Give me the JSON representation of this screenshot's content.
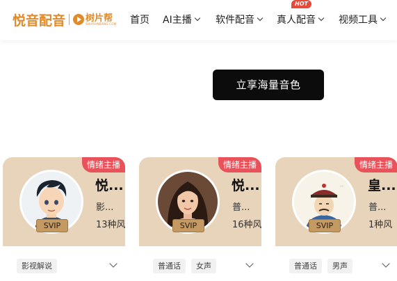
{
  "brand": {
    "logo_main": "悦音配音",
    "logo_sub_cn": "树片帮",
    "logo_sub_en": "SHUPIANBANG.COM"
  },
  "nav": {
    "items": [
      {
        "label": "首页",
        "has_dropdown": false
      },
      {
        "label": "AI主播",
        "has_dropdown": true
      },
      {
        "label": "软件配音",
        "has_dropdown": true
      },
      {
        "label": "真人配音",
        "has_dropdown": true,
        "badge": "HOT"
      },
      {
        "label": "视频工具",
        "has_dropdown": true
      }
    ]
  },
  "cta": {
    "label": "立享海量音色"
  },
  "cards": [
    {
      "ribbon": "情绪主播",
      "name": "悦...",
      "line2": "影...",
      "line3": "13种风",
      "badge": "SVIP",
      "tags": [
        "影视解说"
      ],
      "avatar": "cartoon-boy-avatar"
    },
    {
      "ribbon": "情绪主播",
      "name": "悦...",
      "line2": "普...",
      "line3": "16种风",
      "badge": "SVIP",
      "tags": [
        "普通话",
        "女声"
      ],
      "avatar": "woman-portrait-avatar"
    },
    {
      "ribbon": "情绪主播",
      "name": "皇...",
      "line2": "普...",
      "line3": "1种风",
      "badge": "SVIP",
      "tags": [
        "普通话",
        "男声"
      ],
      "avatar": "qing-official-cartoon-avatar"
    }
  ],
  "colors": {
    "brand_orange": "#e08a2a",
    "ribbon_red": "#e8525a",
    "card_beige": "#e8d3bb",
    "cta_black": "#0c0c0c",
    "svip_gold": "#c49a62"
  }
}
